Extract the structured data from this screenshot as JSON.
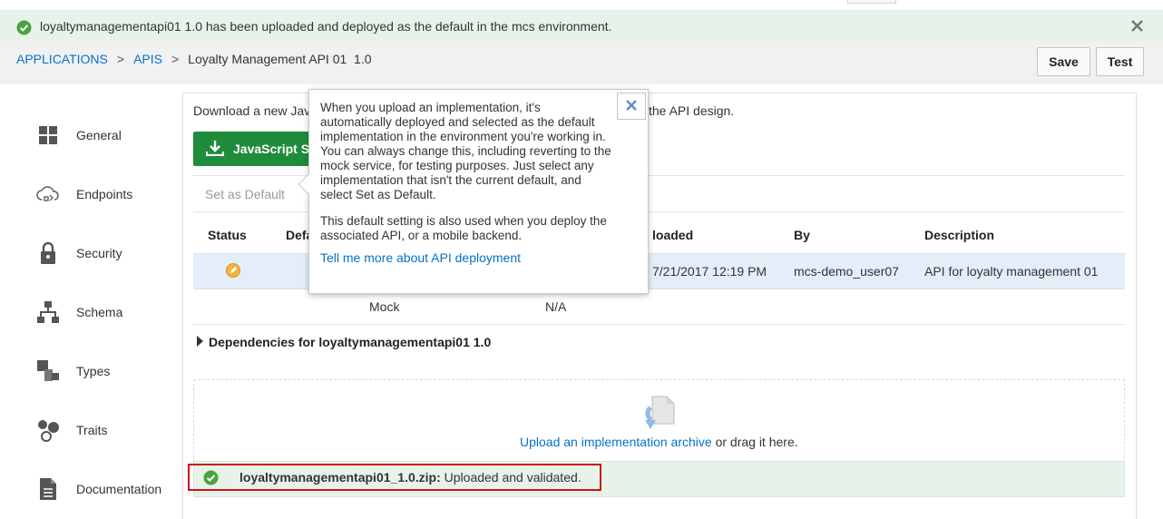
{
  "banner": {
    "message": "loyaltymanagementapi01 1.0 has been uploaded and deployed as the default in the mcs environment.",
    "ok_icon": "check-circle-icon",
    "close_icon": "close-icon"
  },
  "breadcrumb": {
    "applications": "APPLICATIONS",
    "apis": "APIS",
    "separator": ">",
    "current": "Loyalty Management API 01  1.0"
  },
  "toolbar": {
    "save_label": "Save",
    "test_label": "Test"
  },
  "sidebar": {
    "items": [
      {
        "label": "General",
        "icon": "grid-icon"
      },
      {
        "label": "Endpoints",
        "icon": "cloud-icon"
      },
      {
        "label": "Security",
        "icon": "lock-icon"
      },
      {
        "label": "Schema",
        "icon": "hierarchy-icon"
      },
      {
        "label": "Types",
        "icon": "types-icon"
      },
      {
        "label": "Traits",
        "icon": "traits-icon"
      },
      {
        "label": "Documentation",
        "icon": "document-icon"
      }
    ]
  },
  "main": {
    "download_text_start": "Download a new Jav",
    "download_text_end": "the API design.",
    "js_button_label": "JavaScript S",
    "set_default": "Set as Default",
    "columns": {
      "status": "Status",
      "default": "Defa",
      "uploaded": "loaded",
      "by": "By",
      "description": "Description"
    },
    "rows": [
      {
        "uploaded": "7/21/2017 12:19 PM",
        "by": "mcs-demo_user07",
        "description": "API for loyalty management 01"
      },
      {
        "version": "Mock",
        "uploaded": "N/A"
      }
    ],
    "dependencies": "Dependencies for loyaltymanagementapi01 1.0",
    "upload_link": "Upload an implementation archive",
    "upload_suffix": " or drag it here.",
    "success_file": "loyaltymanagementapi01_1.0.zip:",
    "success_status": "Uploaded and validated."
  },
  "popup": {
    "paragraph1": "When you upload an implementation, it's automatically deployed and selected as the default implementation in the environment you're working in. You can always change this, including reverting to the mock service, for testing purposes. Just select any implementation that isn't the current default, and select Set as Default.",
    "paragraph2": "This default setting is also used when you deploy the associated API, or a mobile backend.",
    "link": "Tell me more about API deployment"
  },
  "colors": {
    "accent": "#0572ce",
    "success": "#1f8c3b",
    "highlight": "#d0101a"
  }
}
